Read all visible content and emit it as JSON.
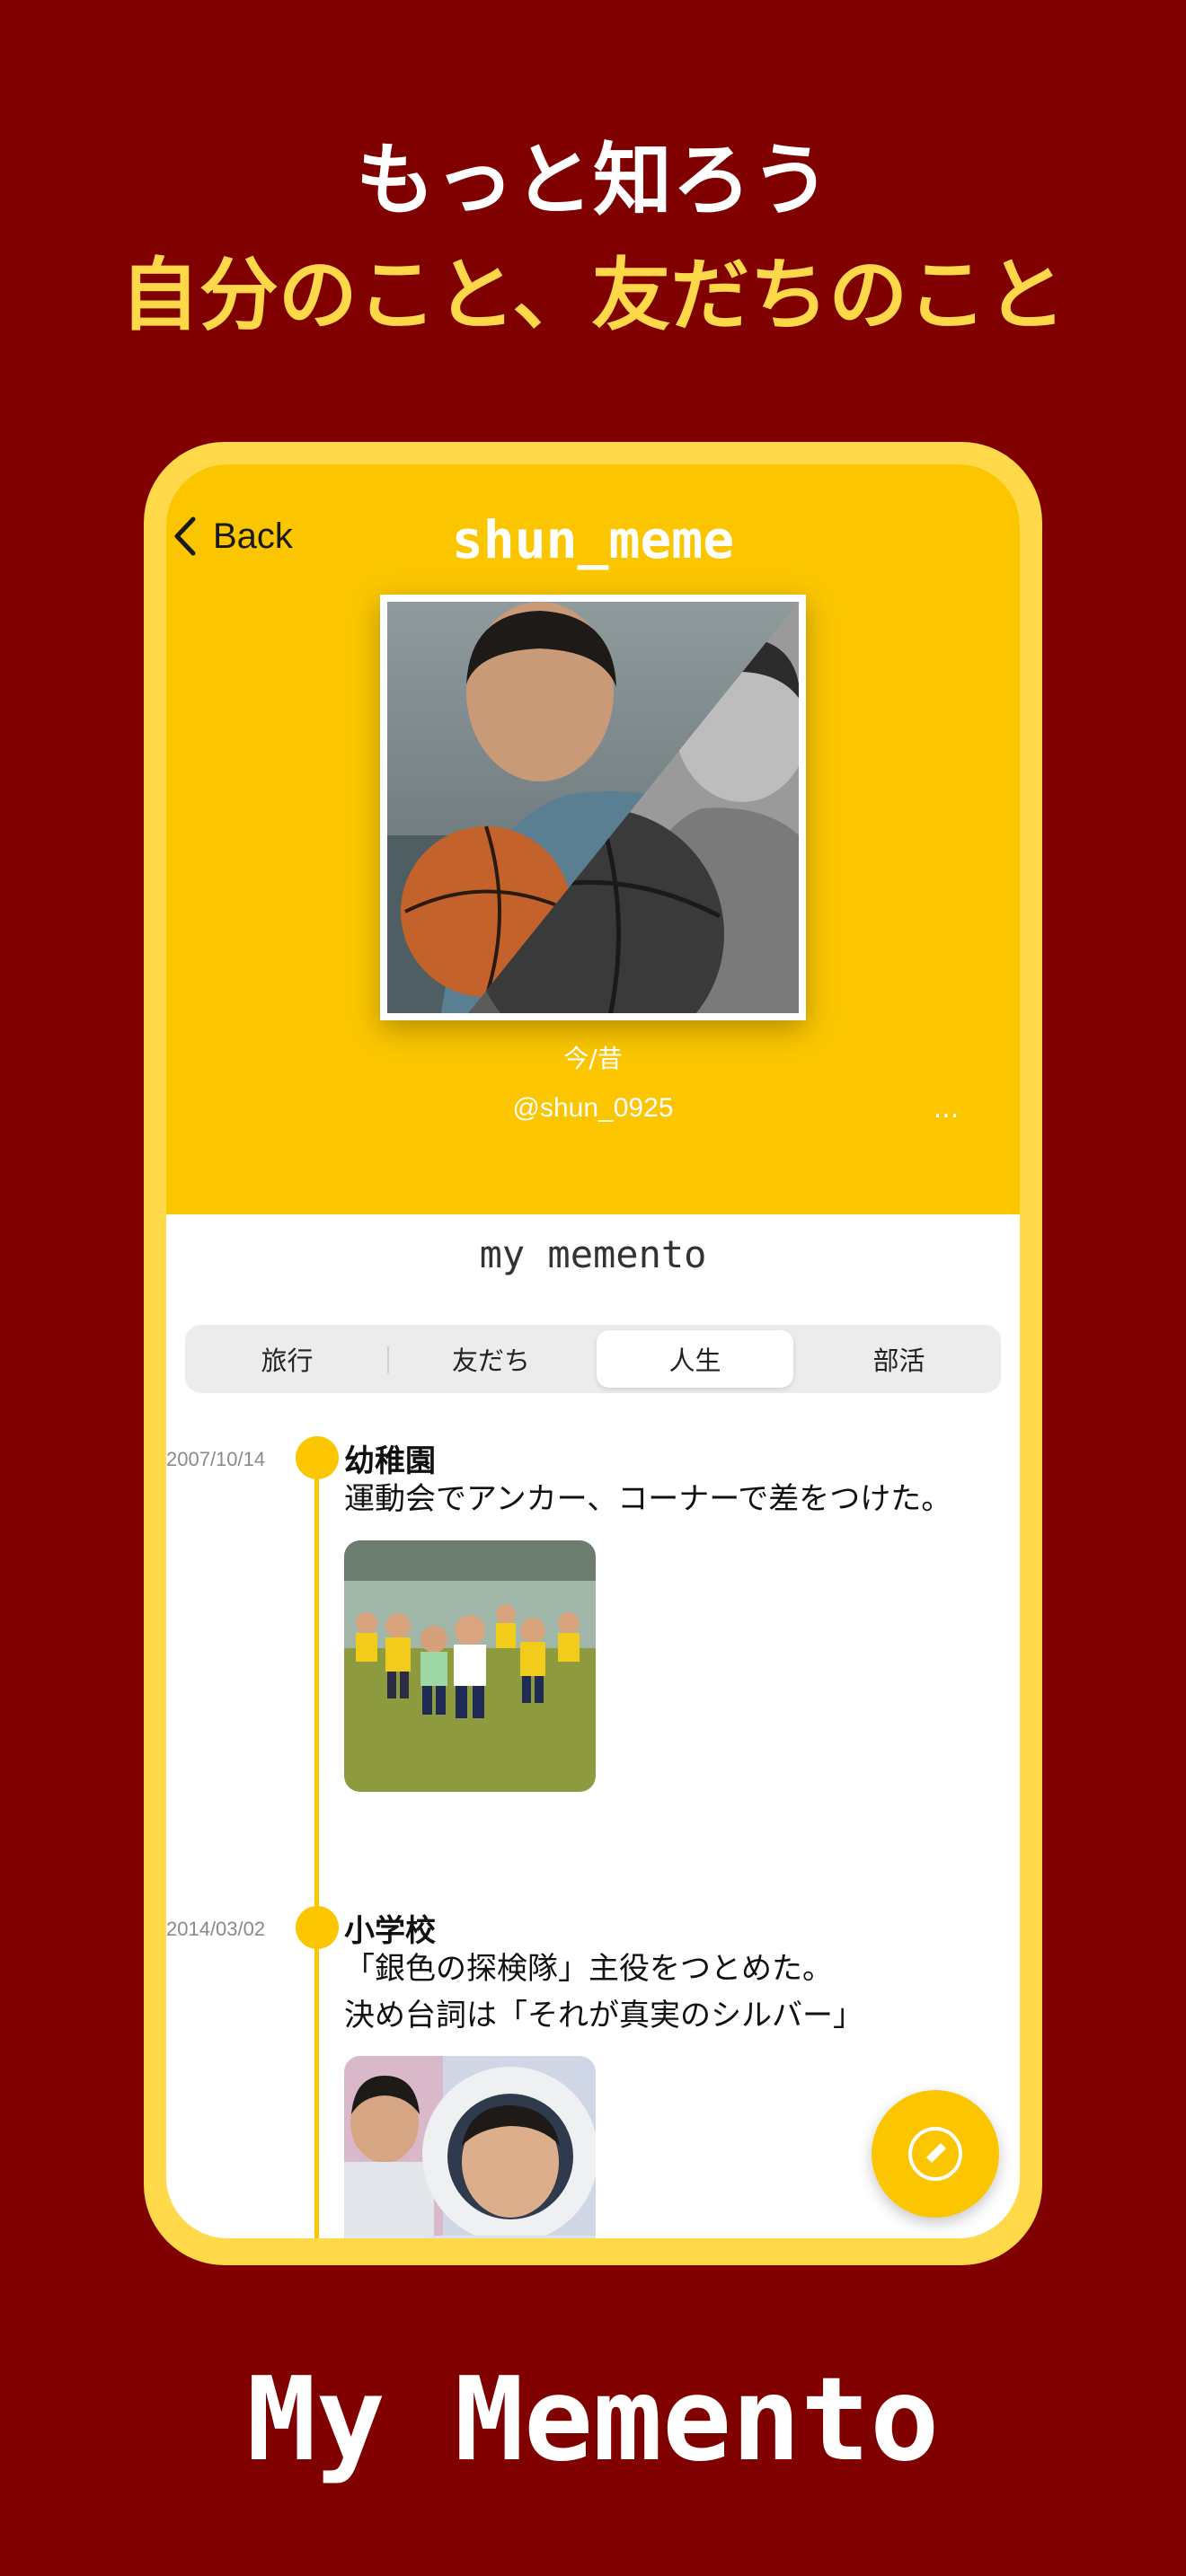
{
  "headline": {
    "line1": "もっと知ろう",
    "line2": "自分のこと、友だちのこと"
  },
  "app_title": "My Memento",
  "profile": {
    "back_label": "Back",
    "username": "shun_meme",
    "photo_caption": "今/昔",
    "handle": "@shun_0925",
    "more_label": "..."
  },
  "memento": {
    "section_title": "my memento",
    "tabs": [
      {
        "label": "旅行",
        "active": false
      },
      {
        "label": "友だち",
        "active": false
      },
      {
        "label": "人生",
        "active": true
      },
      {
        "label": "部活",
        "active": false
      }
    ],
    "entries": [
      {
        "date": "2007/10/14",
        "title": "幼稚園",
        "lines": [
          "運動会でアンカー、コーナーで差をつけた。"
        ]
      },
      {
        "date": "2014/03/02",
        "title": "小学校",
        "lines": [
          "「銀色の探検隊」主役をつとめた。",
          "決め台詞は「それが真実のシルバー」"
        ]
      }
    ]
  },
  "colors": {
    "background": "#800000",
    "accent_yellow": "#fbc600",
    "headline_yellow": "#ffd84a",
    "frame": "#ffd94a"
  },
  "icons": {
    "back": "chevron-left-icon",
    "more": "ellipsis-icon",
    "compose": "pencil-icon"
  }
}
